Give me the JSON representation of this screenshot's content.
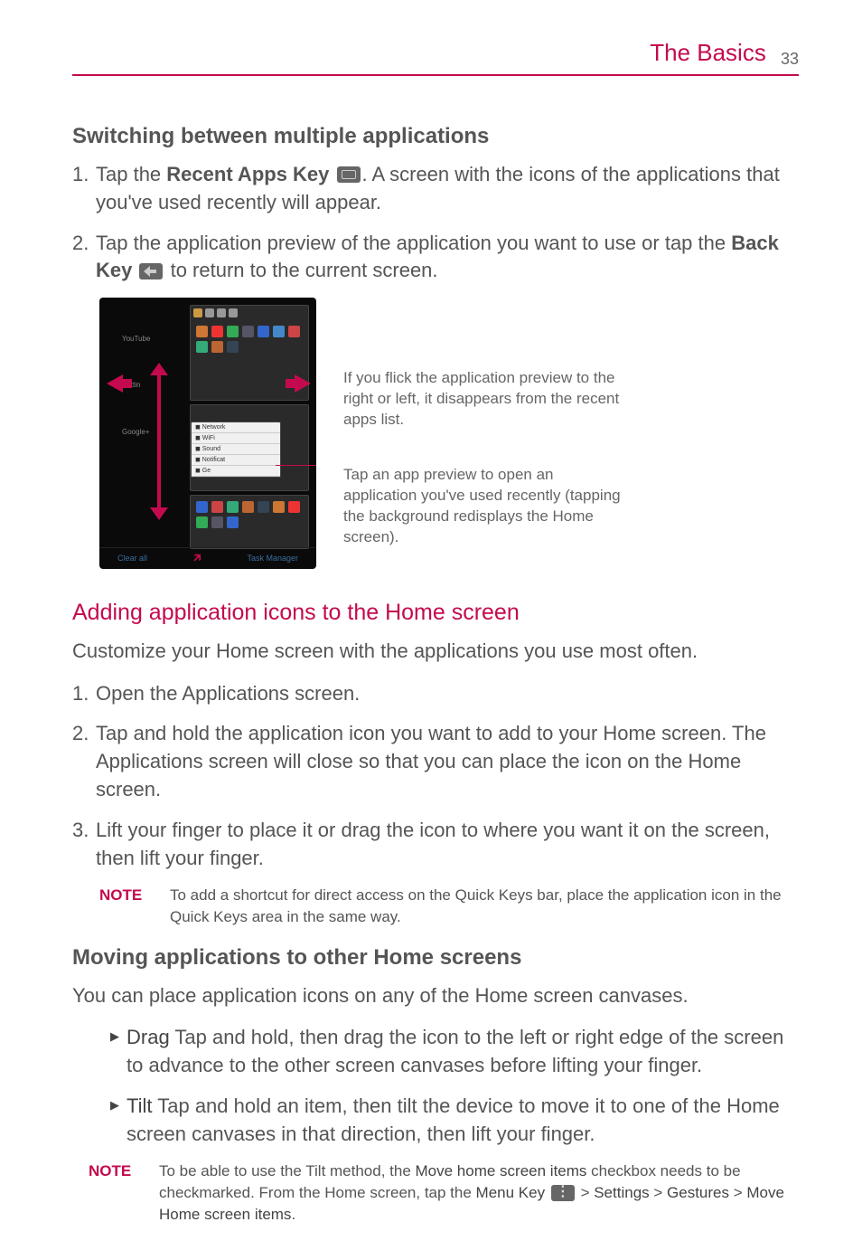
{
  "header": {
    "title": "The Basics",
    "page_number": "33"
  },
  "sec1": {
    "heading": "Switching between multiple applications",
    "step1_pre": "Tap the ",
    "step1_b1": "Recent Apps Key",
    "step1_post": ". A screen with the icons of the applications that you've used recently will appear.",
    "step2_pre": "Tap the application preview of the application you want to use or tap the ",
    "step2_b1": "Back Key",
    "step2_post": " to return to the current screen."
  },
  "figure": {
    "caption1": "If you flick the application preview to the right or left, it disappears from the recent apps list.",
    "caption2": "Tap an app preview to open an application you've used recently (tapping the background redisplays the Home screen).",
    "left_labels": [
      "YouTube",
      "Settin",
      "Google+"
    ],
    "bottom_left": "Clear all",
    "bottom_right": "Task Manager"
  },
  "sec2": {
    "heading": "Adding application icons to the Home screen",
    "intro": "Customize your Home screen with the applications you use most often.",
    "step1": "Open the Applications screen.",
    "step2": "Tap and hold the application icon you want to add to your Home screen. The Applications screen will close so that you can place the icon on the Home screen.",
    "step3": "Lift your finger to place it or drag the icon to where you want it on the screen, then lift your finger."
  },
  "note1": {
    "label": "NOTE",
    "body": "To add a shortcut for direct access on the Quick Keys bar, place the application icon in the Quick Keys area in the same way."
  },
  "sec3": {
    "heading": "Moving applications to other Home screens",
    "intro": "You can place application icons on any of the Home screen canvases.",
    "drag_b": "Drag",
    "drag_t": "  Tap and hold, then drag the icon to the left or right edge of the screen to advance to the other screen canvases before lifting your finger.",
    "tilt_b": "Tilt",
    "tilt_t": "  Tap and hold an item, then tilt the device to move it to one of the Home screen canvases in that direction, then lift your finger."
  },
  "note2": {
    "label": "NOTE",
    "pre": "To be able to use the Tilt method, the ",
    "b1": "Move home screen items",
    "mid1": " checkbox needs to be checkmarked. From the Home screen, tap the ",
    "b2": "Menu Key",
    "mid2": " > ",
    "b3": "Settings",
    "mid3": " > ",
    "b4": "Gestures",
    "mid4": " > ",
    "b5": "Move Home screen items",
    "post": "."
  }
}
